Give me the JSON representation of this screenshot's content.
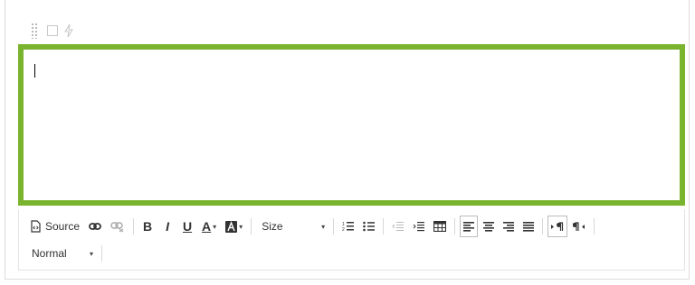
{
  "toolbar": {
    "source_label": "Source",
    "size_label": "Size",
    "format_label": "Normal"
  },
  "colors": {
    "focus_border": "#7ab32e",
    "border": "#dcdcdc",
    "icon": "#333333"
  },
  "icons": [
    "drag-handle-icon",
    "checkbox-icon",
    "bolt-icon",
    "source-icon",
    "link-icon",
    "unlink-icon",
    "bold-icon",
    "italic-icon",
    "underline-icon",
    "text-color-icon",
    "background-color-icon",
    "numbered-list-icon",
    "bulleted-list-icon",
    "outdent-icon",
    "indent-icon",
    "table-icon",
    "align-left-icon",
    "align-center-icon",
    "align-right-icon",
    "justify-icon",
    "ltr-icon",
    "rtl-icon"
  ]
}
